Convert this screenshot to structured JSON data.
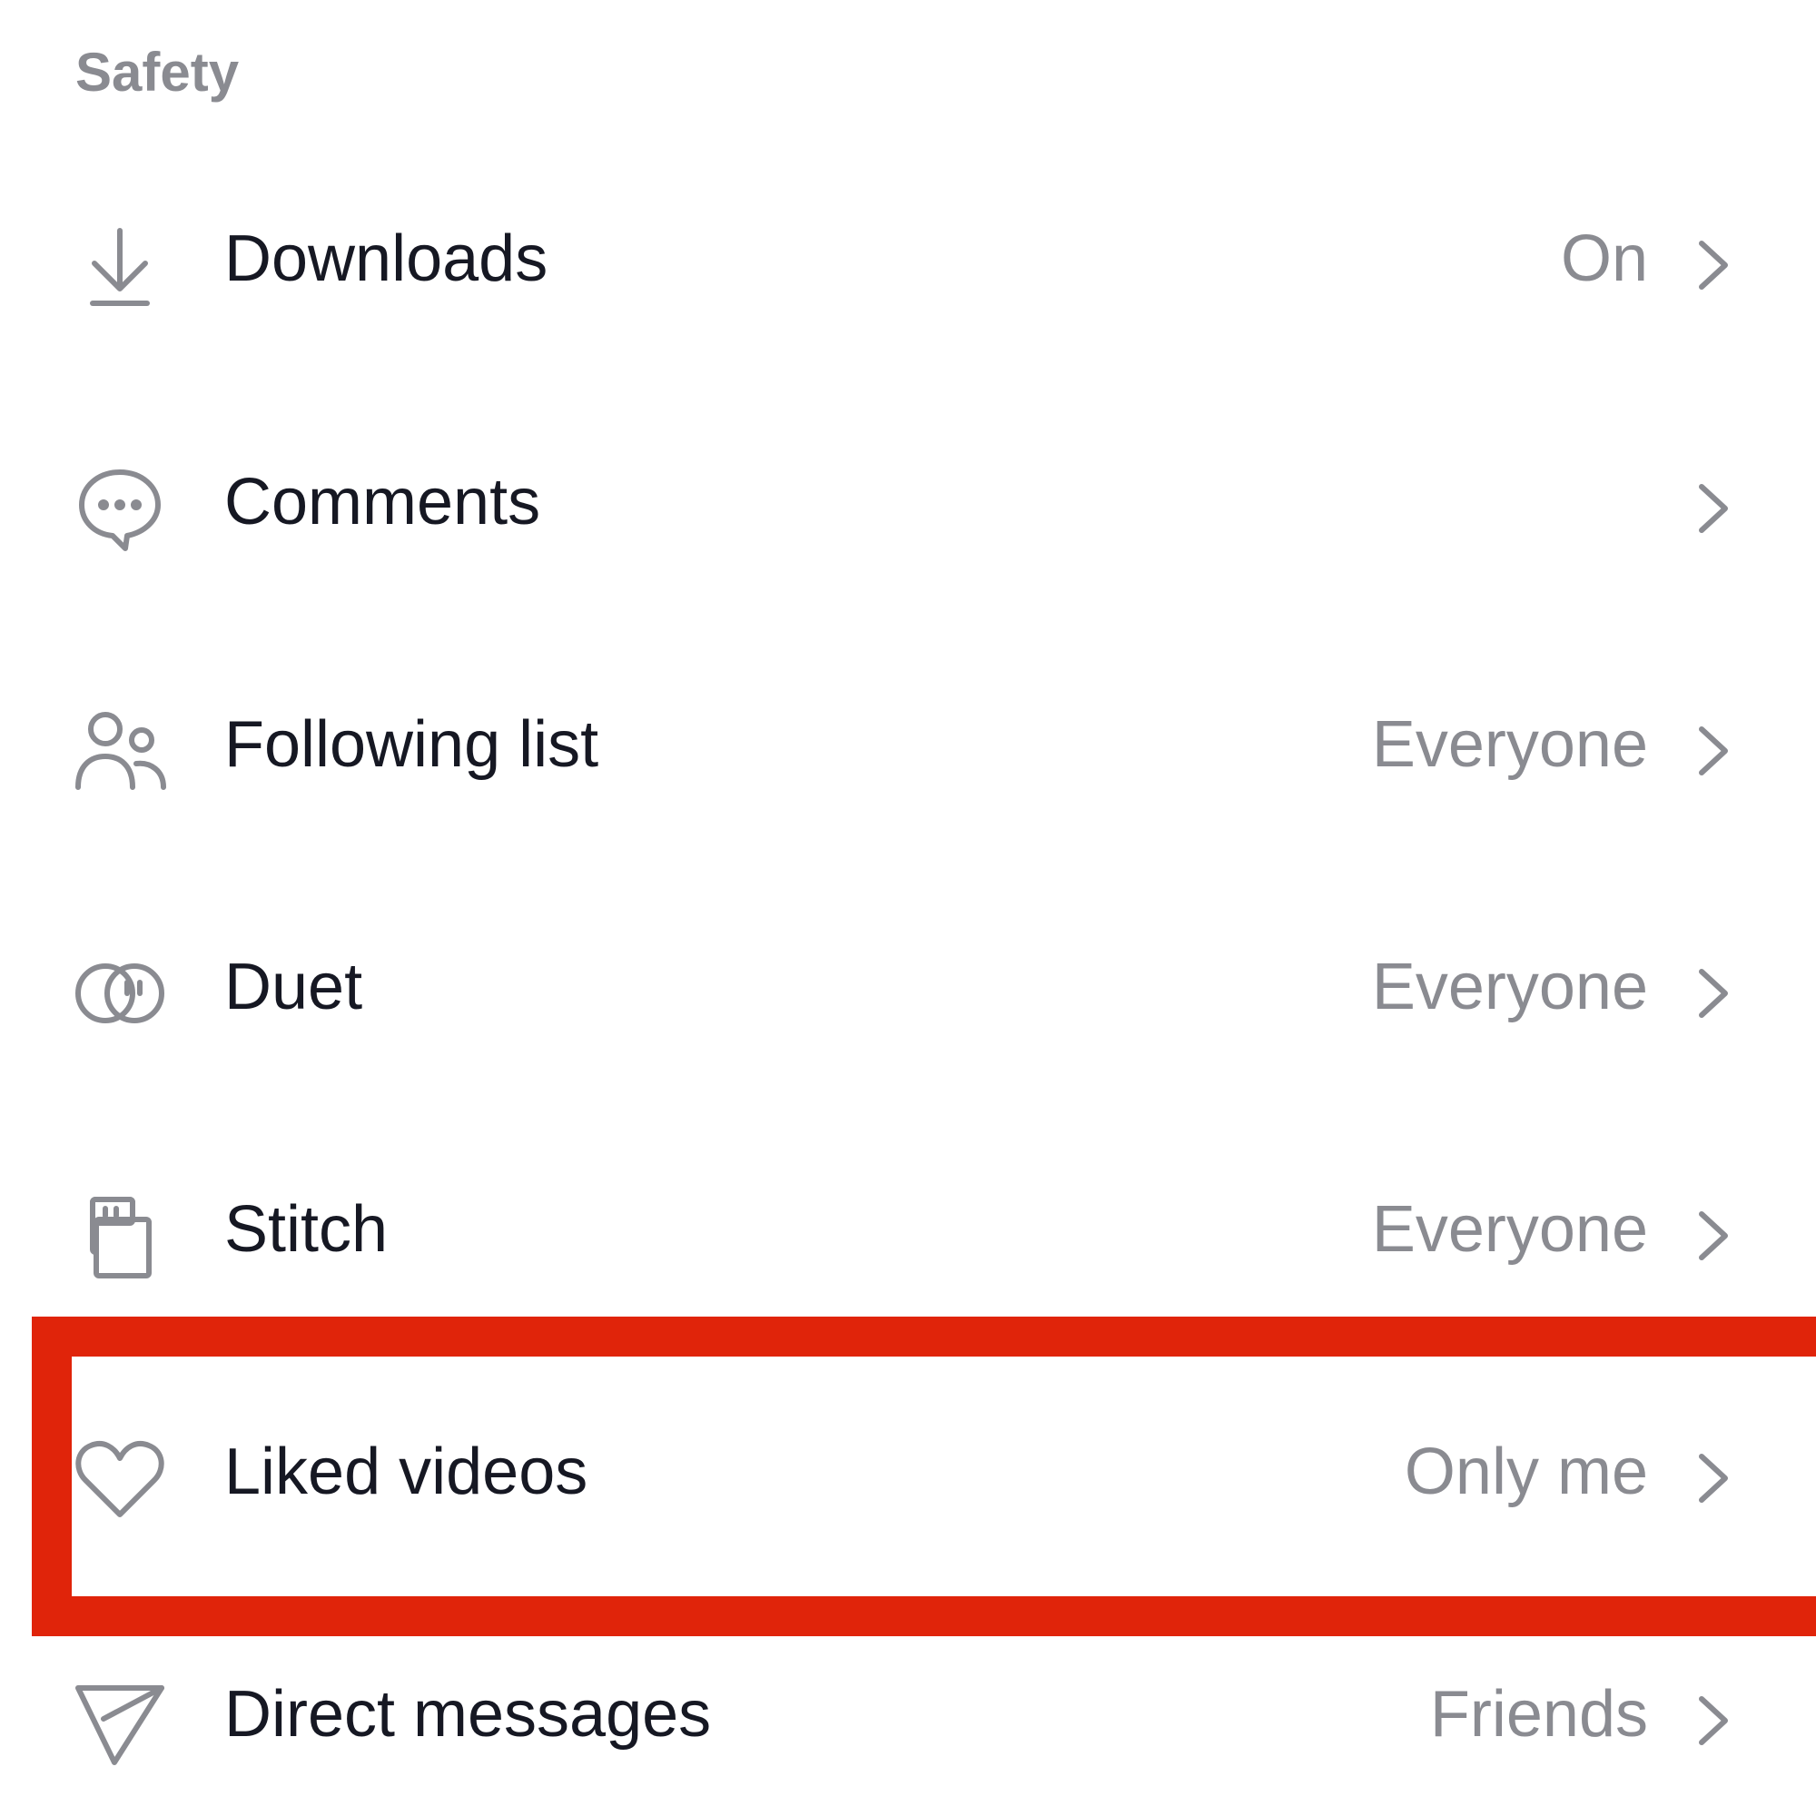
{
  "section": {
    "title": "Safety"
  },
  "rows": [
    {
      "label": "Downloads",
      "value": "On",
      "icon": "download-icon"
    },
    {
      "label": "Comments",
      "value": "",
      "icon": "comment-icon"
    },
    {
      "label": "Following list",
      "value": "Everyone",
      "icon": "people-icon"
    },
    {
      "label": "Duet",
      "value": "Everyone",
      "icon": "duet-icon"
    },
    {
      "label": "Stitch",
      "value": "Everyone",
      "icon": "stitch-icon"
    },
    {
      "label": "Liked videos",
      "value": "Only me",
      "icon": "heart-icon"
    },
    {
      "label": "Direct messages",
      "value": "Friends",
      "icon": "send-icon"
    }
  ],
  "colors": {
    "label": "#161823",
    "value": "#8a8b91",
    "icon": "#8a8b91",
    "highlight": "#e0240a",
    "background": "#ffffff"
  }
}
